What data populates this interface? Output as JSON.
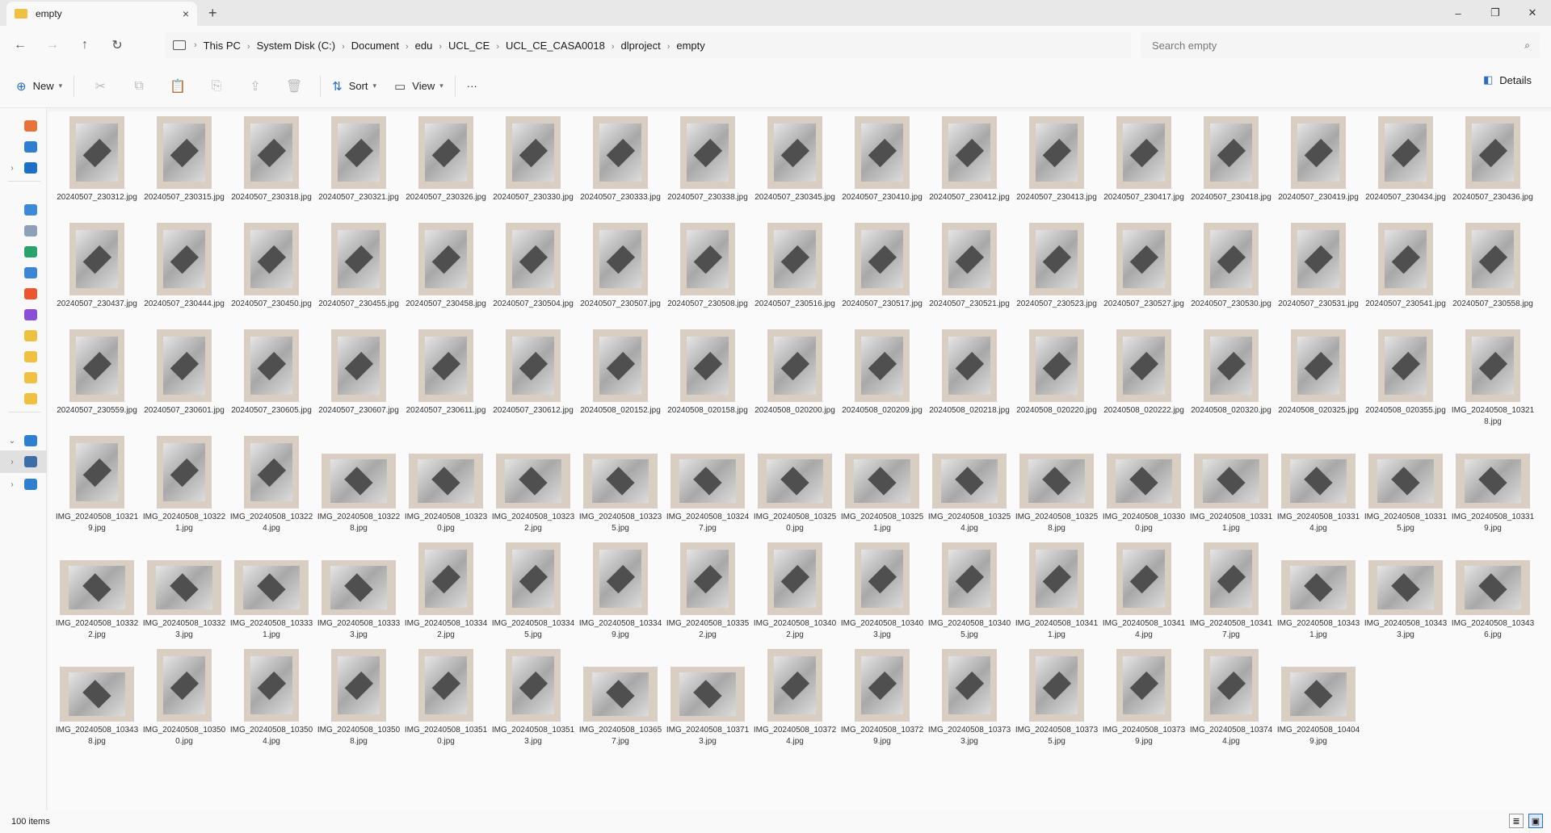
{
  "window": {
    "tab_title": "empty",
    "tab_close": "×",
    "new_tab": "+",
    "minimize": "–",
    "maximize": "❐",
    "close": "✕"
  },
  "nav": {
    "back": "←",
    "forward": "→",
    "up": "↑",
    "refresh": "↻"
  },
  "breadcrumb": [
    "This PC",
    "System Disk (C:)",
    "Document",
    "edu",
    "UCL_CE",
    "UCL_CE_CASA0018",
    "dlproject",
    "empty"
  ],
  "search": {
    "placeholder": "Search empty",
    "icon": "search-icon"
  },
  "toolbar": {
    "new_label": "New",
    "sort_label": "Sort",
    "view_label": "View",
    "more_label": "···",
    "details_label": "Details"
  },
  "sidebar": {
    "items": [
      {
        "icon": "home-icon",
        "color": "#e8733a"
      },
      {
        "icon": "gallery-icon",
        "color": "#2f7fd1"
      },
      {
        "icon": "onedrive-icon",
        "color": "#1e6fc8"
      },
      {
        "icon": "desktop-icon",
        "color": "#3a8ad8"
      },
      {
        "icon": "documents-icon",
        "color": "#8ea0b8"
      },
      {
        "icon": "downloads-icon",
        "color": "#2aa36a"
      },
      {
        "icon": "pictures-icon",
        "color": "#3b86d6"
      },
      {
        "icon": "music-icon",
        "color": "#e8572e"
      },
      {
        "icon": "videos-icon",
        "color": "#8a4fd6"
      },
      {
        "icon": "folder-icon",
        "color": "#f0c040"
      },
      {
        "icon": "folder-icon",
        "color": "#f0c040"
      },
      {
        "icon": "folder-icon",
        "color": "#f0c040"
      },
      {
        "icon": "folder-icon",
        "color": "#f0c040"
      },
      {
        "icon": "this-pc-icon",
        "color": "#2f7fd1"
      },
      {
        "icon": "drive-icon",
        "color": "#3b6ea8"
      },
      {
        "icon": "network-icon",
        "color": "#2f7fd1"
      }
    ]
  },
  "files": [
    "20240507_230312.jpg",
    "20240507_230315.jpg",
    "20240507_230318.jpg",
    "20240507_230321.jpg",
    "20240507_230326.jpg",
    "20240507_230330.jpg",
    "20240507_230333.jpg",
    "20240507_230338.jpg",
    "20240507_230345.jpg",
    "20240507_230410.jpg",
    "20240507_230412.jpg",
    "20240507_230413.jpg",
    "20240507_230417.jpg",
    "20240507_230418.jpg",
    "20240507_230419.jpg",
    "20240507_230434.jpg",
    "20240507_230436.jpg",
    "20240507_230437.jpg",
    "20240507_230444.jpg",
    "20240507_230450.jpg",
    "20240507_230455.jpg",
    "20240507_230458.jpg",
    "20240507_230504.jpg",
    "20240507_230507.jpg",
    "20240507_230508.jpg",
    "20240507_230516.jpg",
    "20240507_230517.jpg",
    "20240507_230521.jpg",
    "20240507_230523.jpg",
    "20240507_230527.jpg",
    "20240507_230530.jpg",
    "20240507_230531.jpg",
    "20240507_230541.jpg",
    "20240507_230558.jpg",
    "20240507_230559.jpg",
    "20240507_230601.jpg",
    "20240507_230605.jpg",
    "20240507_230607.jpg",
    "20240507_230611.jpg",
    "20240507_230612.jpg",
    "20240508_020152.jpg",
    "20240508_020158.jpg",
    "20240508_020200.jpg",
    "20240508_020209.jpg",
    "20240508_020218.jpg",
    "20240508_020220.jpg",
    "20240508_020222.jpg",
    "20240508_020320.jpg",
    "20240508_020325.jpg",
    "20240508_020355.jpg",
    "IMG_20240508_103218.jpg",
    "IMG_20240508_103219.jpg",
    "IMG_20240508_103221.jpg",
    "IMG_20240508_103224.jpg",
    "IMG_20240508_103228.jpg",
    "IMG_20240508_103230.jpg",
    "IMG_20240508_103232.jpg",
    "IMG_20240508_103235.jpg",
    "IMG_20240508_103247.jpg",
    "IMG_20240508_103250.jpg",
    "IMG_20240508_103251.jpg",
    "IMG_20240508_103254.jpg",
    "IMG_20240508_103258.jpg",
    "IMG_20240508_103300.jpg",
    "IMG_20240508_103311.jpg",
    "IMG_20240508_103314.jpg",
    "IMG_20240508_103315.jpg",
    "IMG_20240508_103319.jpg",
    "IMG_20240508_103322.jpg",
    "IMG_20240508_103323.jpg",
    "IMG_20240508_103331.jpg",
    "IMG_20240508_103333.jpg",
    "IMG_20240508_103342.jpg",
    "IMG_20240508_103345.jpg",
    "IMG_20240508_103349.jpg",
    "IMG_20240508_103352.jpg",
    "IMG_20240508_103402.jpg",
    "IMG_20240508_103403.jpg",
    "IMG_20240508_103405.jpg",
    "IMG_20240508_103411.jpg",
    "IMG_20240508_103414.jpg",
    "IMG_20240508_103417.jpg",
    "IMG_20240508_103431.jpg",
    "IMG_20240508_103433.jpg",
    "IMG_20240508_103436.jpg",
    "IMG_20240508_103438.jpg",
    "IMG_20240508_103500.jpg",
    "IMG_20240508_103504.jpg",
    "IMG_20240508_103508.jpg",
    "IMG_20240508_103510.jpg",
    "IMG_20240508_103513.jpg",
    "IMG_20240508_103657.jpg",
    "IMG_20240508_103713.jpg",
    "IMG_20240508_103724.jpg",
    "IMG_20240508_103729.jpg",
    "IMG_20240508_103733.jpg",
    "IMG_20240508_103735.jpg",
    "IMG_20240508_103739.jpg",
    "IMG_20240508_103744.jpg",
    "IMG_20240508_104049.jpg"
  ],
  "status": {
    "item_count": "100 items"
  }
}
